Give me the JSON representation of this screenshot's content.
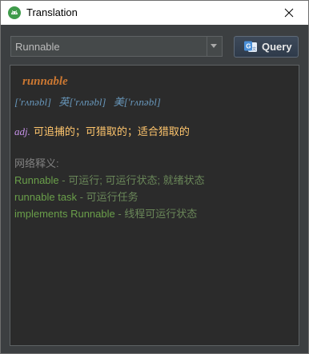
{
  "window": {
    "title": "Translation"
  },
  "toolbar": {
    "query_input": "Runnable",
    "query_button_label": "Query"
  },
  "result": {
    "word": "runnable",
    "phonetics": [
      {
        "prefix": "",
        "ipa": "['rʌnəbl]"
      },
      {
        "prefix": "英",
        "ipa": "['rʌnəbl]"
      },
      {
        "prefix": "美",
        "ipa": "['rʌnəbl]"
      }
    ],
    "definition": {
      "pos": "adj.",
      "meaning": "可追捕的；可猎取的；适合猎取的"
    },
    "web_title": "网络释义:",
    "web_translations": [
      {
        "key": "Runnable",
        "sep": " - ",
        "value": "可运行; 可运行状态; 就绪状态"
      },
      {
        "key": "runnable task",
        "sep": " - ",
        "value": "可运行任务"
      },
      {
        "key": "implements Runnable",
        "sep": " - ",
        "value": "线程可运行状态"
      }
    ]
  },
  "colors": {
    "titlebar_bg": "#ffffff",
    "window_bg": "#3c3f41",
    "panel_bg": "#2b2b2b",
    "word": "#cc7832",
    "phonetic": "#6897bb",
    "pos": "#c792ea",
    "meaning": "#ffc66d",
    "web_title": "#808080",
    "web_key": "#6a9f4a",
    "web_value": "#6a8759"
  },
  "icons": {
    "app": "android-icon",
    "close": "close-icon",
    "combo": "chevron-down-icon",
    "query": "translate-icon"
  }
}
